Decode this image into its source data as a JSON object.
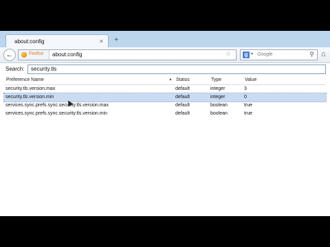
{
  "browser": {
    "tab_title": "about:config",
    "tab_close": "×",
    "new_tab": "+",
    "back": "←",
    "identity_label": "Firefox",
    "url": "about:config",
    "bookmark_star": "☆",
    "reload": "C",
    "search_engine": "g",
    "search_dropdown": "▾",
    "search_placeholder": "Google",
    "search_go": "⚲",
    "home": "⌂"
  },
  "config": {
    "search_label": "Search:",
    "filter_value": "security.tls",
    "columns": [
      "Preference Name",
      "Status",
      "Type",
      "Value"
    ],
    "sort_icon": "▲",
    "rows": [
      {
        "name": "security.tls.version.max",
        "status": "default",
        "type": "integer",
        "value": "3"
      },
      {
        "name": "security.tls.version.min",
        "status": "default",
        "type": "integer",
        "value": "0"
      },
      {
        "name": "services.sync.prefs.sync.security.tls.version.max",
        "status": "default",
        "type": "boolean",
        "value": "true"
      },
      {
        "name": "services.sync.prefs.sync.security.tls.version.min",
        "status": "default",
        "type": "boolean",
        "value": "true"
      }
    ],
    "selected_row": 1
  }
}
